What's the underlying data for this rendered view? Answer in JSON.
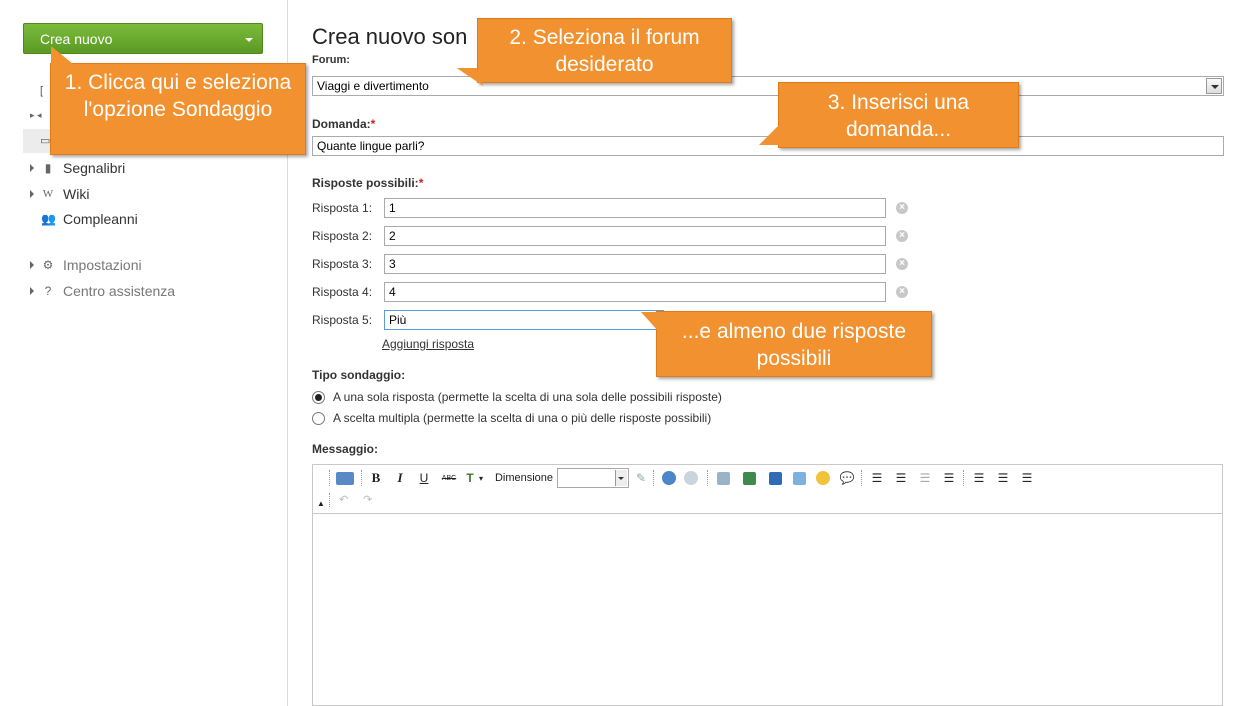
{
  "sidebar": {
    "create_button": "Crea nuovo",
    "items": [
      {
        "label": "Segnalibri",
        "icon": "bookmark-icon"
      },
      {
        "label": "Wiki",
        "icon": "wiki-icon"
      },
      {
        "label": "Compleanni",
        "icon": "people-icon"
      },
      {
        "label": "Impostazioni",
        "icon": "gear-icon"
      },
      {
        "label": "Centro assistenza",
        "icon": "help-icon"
      }
    ]
  },
  "page": {
    "title": "Crea nuovo son",
    "forum_label": "Forum:",
    "forum_value": "Viaggi e divertimento",
    "question_label": "Domanda:",
    "question_value": "Quante lingue parli?",
    "answers_label": "Risposte possibili:",
    "required_mark": "*",
    "answers": [
      {
        "label": "Risposta 1:",
        "value": "1"
      },
      {
        "label": "Risposta 2:",
        "value": "2"
      },
      {
        "label": "Risposta 3:",
        "value": "3"
      },
      {
        "label": "Risposta 4:",
        "value": "4"
      },
      {
        "label": "Risposta 5:",
        "value": "Più"
      }
    ],
    "add_answer_link": "Aggiungi risposta",
    "poll_type_label": "Tipo sondaggio:",
    "poll_type_options": [
      {
        "label": "A una sola risposta (permette la scelta di una sola delle possibili risposte)",
        "selected": true
      },
      {
        "label": "A scelta multipla (permette la scelta di una o più delle risposte possibili)",
        "selected": false
      }
    ],
    "message_label": "Messaggio:"
  },
  "editor": {
    "font_size_label": "Dimensione",
    "bold": "B",
    "italic": "I",
    "underline": "U",
    "strike": "ABC"
  },
  "callouts": {
    "c1": "1. Clicca qui e seleziona l'opzione Sondaggio",
    "c2": "2. Seleziona il forum desiderato",
    "c3": "3. Inserisci una domanda...",
    "c4": "...e almeno due risposte possibili"
  },
  "colors": {
    "create_button": "#6aab2f",
    "callout": "#f2912f"
  }
}
